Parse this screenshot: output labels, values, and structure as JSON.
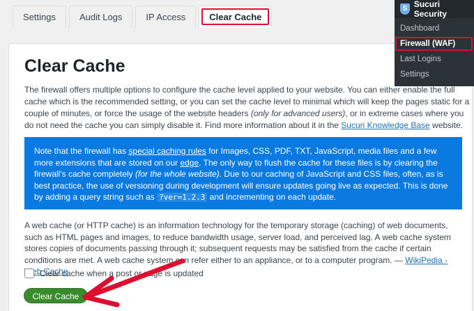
{
  "tabs": [
    "Settings",
    "Audit Logs",
    "IP Access",
    "Clear Cache"
  ],
  "page_title": "Clear Cache",
  "intro": {
    "p1": "The firewall offers multiple options to configure the cache level applied to your website. You can either enable the full cache which is the recommended setting, or you can set the cache level to minimal which will keep the pages static for a couple of minutes, or force the usage of the website headers ",
    "p1_em": "(only for advanced users)",
    "p2": ", or in extreme cases where you do not need the cache you can simply disable it. Find more information about it in the ",
    "link": "Sucuri Knowledge Base",
    "p3": " website."
  },
  "notice": {
    "t1": "Note that the firewall has ",
    "link1": "special caching rules",
    "t2": " for Images, CSS, PDF, TXT, JavaScript, media files and a few more extensions that are stored on our ",
    "link2": "edge",
    "t3": ". The only way to flush the cache for these files is by clearing the firewall's cache completely ",
    "em": "(for the whole website)",
    "t4": ". Due to our caching of JavaScript and CSS files, often, as is best practice, the use of versioning during development will ensure updates going live as expected. This is done by adding a query string such as ",
    "code": "?ver=1.2.3",
    "t5": " and incrementing on each update."
  },
  "webcache": {
    "text": "A web cache (or HTTP cache) is an information technology for the temporary storage (caching) of web documents, such as HTML pages and images, to reduce bandwidth usage, server load, and perceived lag. A web cache system stores copies of documents passing through it; subsequent requests may be satisfied from the cache if certain conditions are met. A web cache system can refer either to an appliance, or to a computer program. — ",
    "link": "WikiPedia - Web Cache"
  },
  "checkbox_label": "Clear cache when a post or page is updated",
  "button_label": "Clear Cache",
  "sucuri_menu": {
    "title": "Sucuri Security",
    "shield_glyph": "S",
    "items": [
      "Dashboard",
      "Firewall (WAF)",
      "Last Logins",
      "Settings"
    ]
  },
  "colors": {
    "highlight": "#e00e2e",
    "notice_bg": "#0a7ae0",
    "button_bg": "#3a8b2d",
    "arrow": "#e00e2e"
  }
}
